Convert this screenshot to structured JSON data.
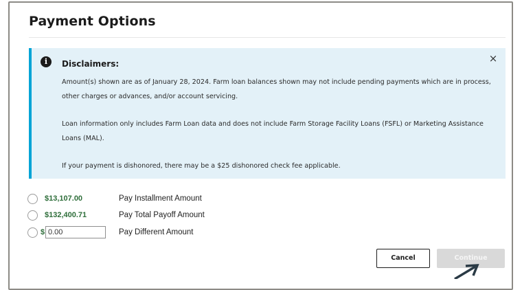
{
  "dialog": {
    "title": "Payment Options"
  },
  "disclaimer": {
    "heading": "Disclaimers:",
    "close_glyph": "×",
    "info_glyph": "i",
    "paragraphs": [
      "Amount(s) shown are as of January 28, 2024. Farm loan balances shown may not include pending payments which are in process, other charges or advances, and/or account servicing.",
      "Loan information only includes Farm Loan data and does not include Farm Storage Facility Loans (FSFL) or Marketing Assistance Loans (MAL).",
      "If your payment is dishonored, there may be a $25 dishonored check fee applicable."
    ]
  },
  "options": [
    {
      "amount": "$13,107.00",
      "label": "Pay Installment Amount"
    },
    {
      "amount": "$132,400.71",
      "label": "Pay Total Payoff Amount"
    },
    {
      "amount_prefix": "$",
      "input_value": "0.00",
      "label": "Pay Different Amount"
    }
  ],
  "buttons": {
    "cancel": "Cancel",
    "continue": "Continue"
  },
  "colors": {
    "alert_bg": "#e3f1f8",
    "alert_border": "#00a4d6",
    "amount_green": "#2e6e3a",
    "disabled_button": "#d9d9d9"
  },
  "icons": {
    "info": "info-icon",
    "close": "close-icon",
    "arrow": "arrow-up-right-icon"
  }
}
